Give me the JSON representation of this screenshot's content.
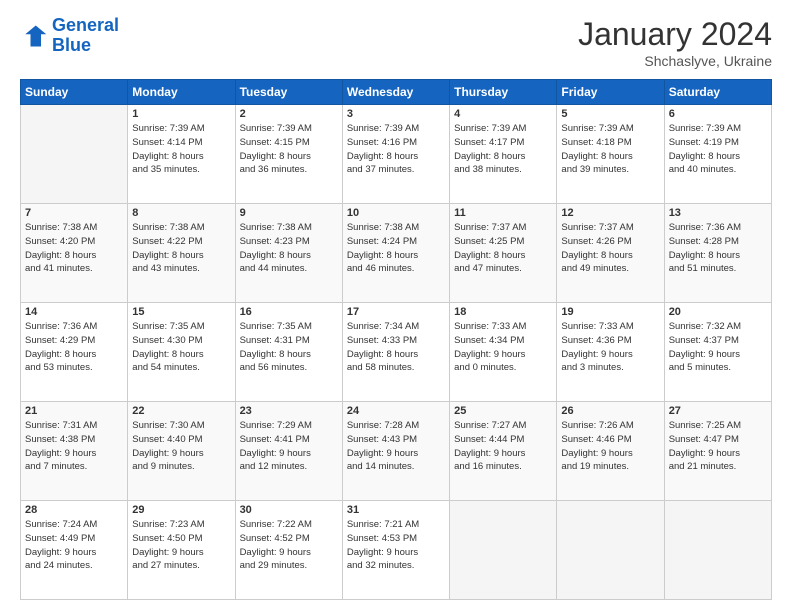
{
  "logo": {
    "line1": "General",
    "line2": "Blue"
  },
  "title": "January 2024",
  "subtitle": "Shchaslyve, Ukraine",
  "days_header": [
    "Sunday",
    "Monday",
    "Tuesday",
    "Wednesday",
    "Thursday",
    "Friday",
    "Saturday"
  ],
  "weeks": [
    [
      {
        "num": "",
        "text": ""
      },
      {
        "num": "1",
        "text": "Sunrise: 7:39 AM\nSunset: 4:14 PM\nDaylight: 8 hours\nand 35 minutes."
      },
      {
        "num": "2",
        "text": "Sunrise: 7:39 AM\nSunset: 4:15 PM\nDaylight: 8 hours\nand 36 minutes."
      },
      {
        "num": "3",
        "text": "Sunrise: 7:39 AM\nSunset: 4:16 PM\nDaylight: 8 hours\nand 37 minutes."
      },
      {
        "num": "4",
        "text": "Sunrise: 7:39 AM\nSunset: 4:17 PM\nDaylight: 8 hours\nand 38 minutes."
      },
      {
        "num": "5",
        "text": "Sunrise: 7:39 AM\nSunset: 4:18 PM\nDaylight: 8 hours\nand 39 minutes."
      },
      {
        "num": "6",
        "text": "Sunrise: 7:39 AM\nSunset: 4:19 PM\nDaylight: 8 hours\nand 40 minutes."
      }
    ],
    [
      {
        "num": "7",
        "text": "Sunrise: 7:38 AM\nSunset: 4:20 PM\nDaylight: 8 hours\nand 41 minutes."
      },
      {
        "num": "8",
        "text": "Sunrise: 7:38 AM\nSunset: 4:22 PM\nDaylight: 8 hours\nand 43 minutes."
      },
      {
        "num": "9",
        "text": "Sunrise: 7:38 AM\nSunset: 4:23 PM\nDaylight: 8 hours\nand 44 minutes."
      },
      {
        "num": "10",
        "text": "Sunrise: 7:38 AM\nSunset: 4:24 PM\nDaylight: 8 hours\nand 46 minutes."
      },
      {
        "num": "11",
        "text": "Sunrise: 7:37 AM\nSunset: 4:25 PM\nDaylight: 8 hours\nand 47 minutes."
      },
      {
        "num": "12",
        "text": "Sunrise: 7:37 AM\nSunset: 4:26 PM\nDaylight: 8 hours\nand 49 minutes."
      },
      {
        "num": "13",
        "text": "Sunrise: 7:36 AM\nSunset: 4:28 PM\nDaylight: 8 hours\nand 51 minutes."
      }
    ],
    [
      {
        "num": "14",
        "text": "Sunrise: 7:36 AM\nSunset: 4:29 PM\nDaylight: 8 hours\nand 53 minutes."
      },
      {
        "num": "15",
        "text": "Sunrise: 7:35 AM\nSunset: 4:30 PM\nDaylight: 8 hours\nand 54 minutes."
      },
      {
        "num": "16",
        "text": "Sunrise: 7:35 AM\nSunset: 4:31 PM\nDaylight: 8 hours\nand 56 minutes."
      },
      {
        "num": "17",
        "text": "Sunrise: 7:34 AM\nSunset: 4:33 PM\nDaylight: 8 hours\nand 58 minutes."
      },
      {
        "num": "18",
        "text": "Sunrise: 7:33 AM\nSunset: 4:34 PM\nDaylight: 9 hours\nand 0 minutes."
      },
      {
        "num": "19",
        "text": "Sunrise: 7:33 AM\nSunset: 4:36 PM\nDaylight: 9 hours\nand 3 minutes."
      },
      {
        "num": "20",
        "text": "Sunrise: 7:32 AM\nSunset: 4:37 PM\nDaylight: 9 hours\nand 5 minutes."
      }
    ],
    [
      {
        "num": "21",
        "text": "Sunrise: 7:31 AM\nSunset: 4:38 PM\nDaylight: 9 hours\nand 7 minutes."
      },
      {
        "num": "22",
        "text": "Sunrise: 7:30 AM\nSunset: 4:40 PM\nDaylight: 9 hours\nand 9 minutes."
      },
      {
        "num": "23",
        "text": "Sunrise: 7:29 AM\nSunset: 4:41 PM\nDaylight: 9 hours\nand 12 minutes."
      },
      {
        "num": "24",
        "text": "Sunrise: 7:28 AM\nSunset: 4:43 PM\nDaylight: 9 hours\nand 14 minutes."
      },
      {
        "num": "25",
        "text": "Sunrise: 7:27 AM\nSunset: 4:44 PM\nDaylight: 9 hours\nand 16 minutes."
      },
      {
        "num": "26",
        "text": "Sunrise: 7:26 AM\nSunset: 4:46 PM\nDaylight: 9 hours\nand 19 minutes."
      },
      {
        "num": "27",
        "text": "Sunrise: 7:25 AM\nSunset: 4:47 PM\nDaylight: 9 hours\nand 21 minutes."
      }
    ],
    [
      {
        "num": "28",
        "text": "Sunrise: 7:24 AM\nSunset: 4:49 PM\nDaylight: 9 hours\nand 24 minutes."
      },
      {
        "num": "29",
        "text": "Sunrise: 7:23 AM\nSunset: 4:50 PM\nDaylight: 9 hours\nand 27 minutes."
      },
      {
        "num": "30",
        "text": "Sunrise: 7:22 AM\nSunset: 4:52 PM\nDaylight: 9 hours\nand 29 minutes."
      },
      {
        "num": "31",
        "text": "Sunrise: 7:21 AM\nSunset: 4:53 PM\nDaylight: 9 hours\nand 32 minutes."
      },
      {
        "num": "",
        "text": ""
      },
      {
        "num": "",
        "text": ""
      },
      {
        "num": "",
        "text": ""
      }
    ]
  ]
}
